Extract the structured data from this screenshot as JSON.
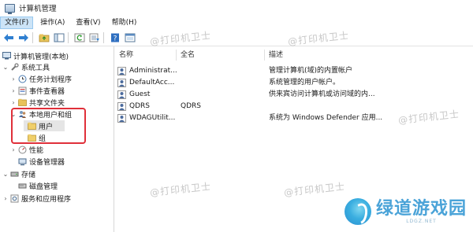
{
  "window": {
    "title": "计算机管理"
  },
  "menu": [
    {
      "label": "文件(F)"
    },
    {
      "label": "操作(A)"
    },
    {
      "label": "查看(V)"
    },
    {
      "label": "帮助(H)"
    }
  ],
  "toolbar": {
    "icons": [
      "back-arrow-icon",
      "forward-arrow-icon",
      "up-folder-icon",
      "show-hide-tree-icon",
      "refresh-icon",
      "export-list-icon",
      "help-icon",
      "properties-icon"
    ]
  },
  "tree": {
    "root": "计算机管理(本地)",
    "system_tools": "系统工具",
    "task_scheduler": "任务计划程序",
    "event_viewer": "事件查看器",
    "shared_folders": "共享文件夹",
    "local_users_groups": "本地用户和组",
    "users": "用户",
    "groups": "组",
    "performance": "性能",
    "device_manager": "设备管理器",
    "storage": "存储",
    "disk_management": "磁盘管理",
    "services_apps": "服务和应用程序"
  },
  "table": {
    "columns": [
      "名称",
      "全名",
      "描述"
    ],
    "rows": [
      {
        "name": "Administrat...",
        "fullname": "",
        "description": "管理计算机(域)的内置帐户"
      },
      {
        "name": "DefaultAcc...",
        "fullname": "",
        "description": "系统管理的用户帐户。"
      },
      {
        "name": "Guest",
        "fullname": "",
        "description": "供来宾访问计算机或访问域的内..."
      },
      {
        "name": "QDRS",
        "fullname": "QDRS",
        "description": ""
      },
      {
        "name": "WDAGUtilit...",
        "fullname": "",
        "description": "系统为 Windows Defender 应用..."
      }
    ]
  },
  "watermark": {
    "text": "@打印机卫士"
  },
  "brand": {
    "name": "绿道游戏园",
    "sub": "LDGZ.NET"
  },
  "colors": {
    "highlight": "#e0303a",
    "selected_bg": "#e5e5e5",
    "menu_active": "#cce4f7",
    "brand": "#4aa3d8"
  }
}
